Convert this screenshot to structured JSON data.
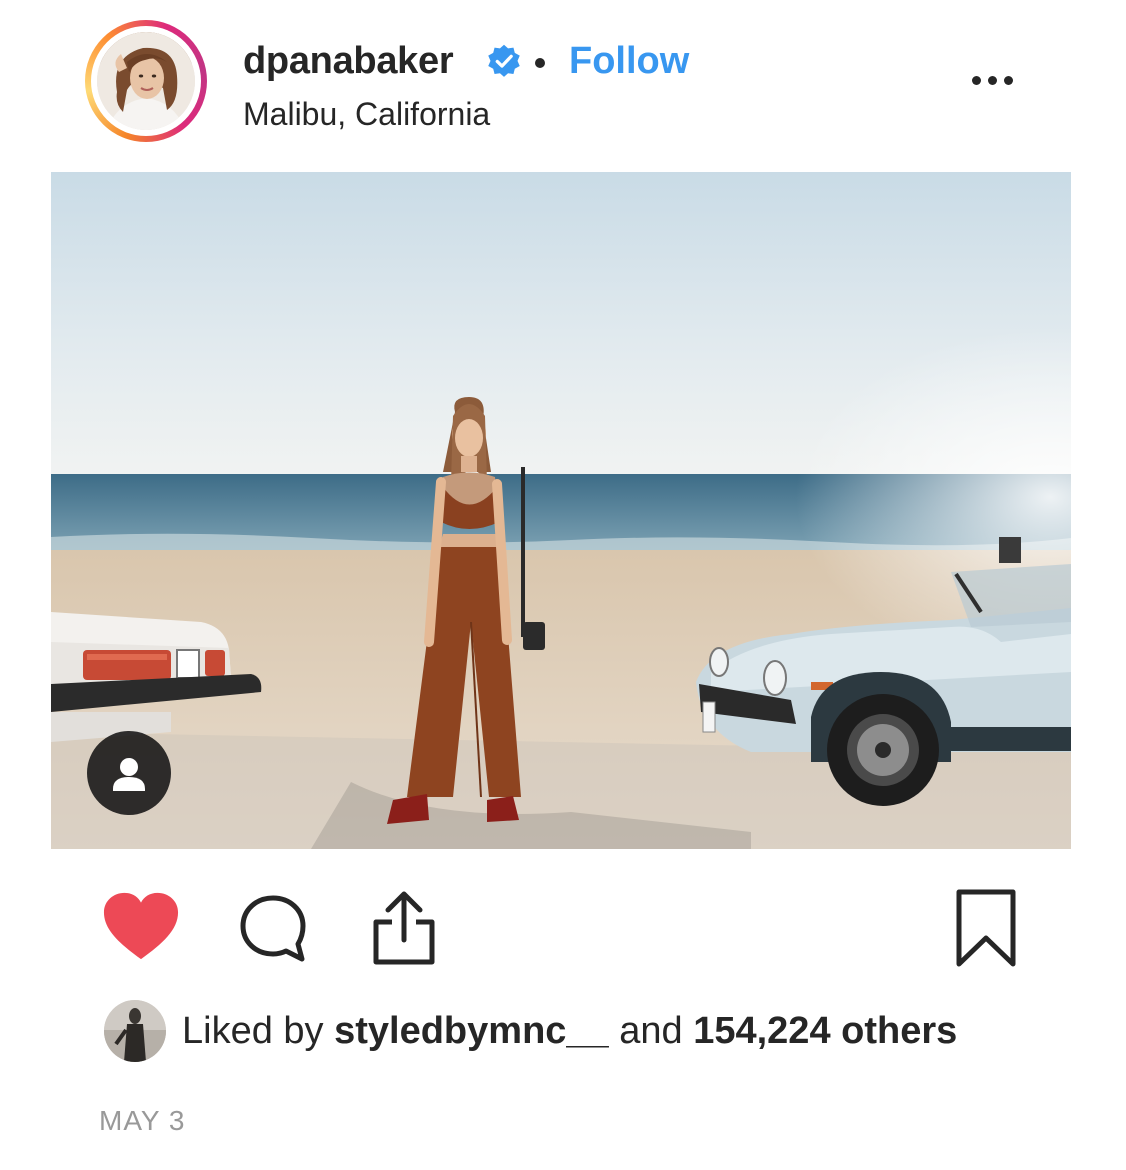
{
  "header": {
    "username": "dpanabaker",
    "separator": "•",
    "follow_label": "Follow",
    "location": "Malibu, California",
    "verified_icon": "verified-badge-icon",
    "more_icon": "more-options-icon"
  },
  "post": {
    "tag_icon": "user-tag-icon",
    "actions": {
      "like_icon": "heart-icon",
      "comment_icon": "comment-icon",
      "share_icon": "share-icon",
      "save_icon": "bookmark-icon"
    },
    "likes": {
      "prefix": "Liked by",
      "user": "styledbymnc__",
      "conjunction": "and",
      "count": "154,224 others"
    },
    "date": "MAY 3"
  },
  "colors": {
    "follow": "#3897f0",
    "liked_heart": "#ed4956",
    "text": "#262626",
    "muted": "#999999"
  }
}
